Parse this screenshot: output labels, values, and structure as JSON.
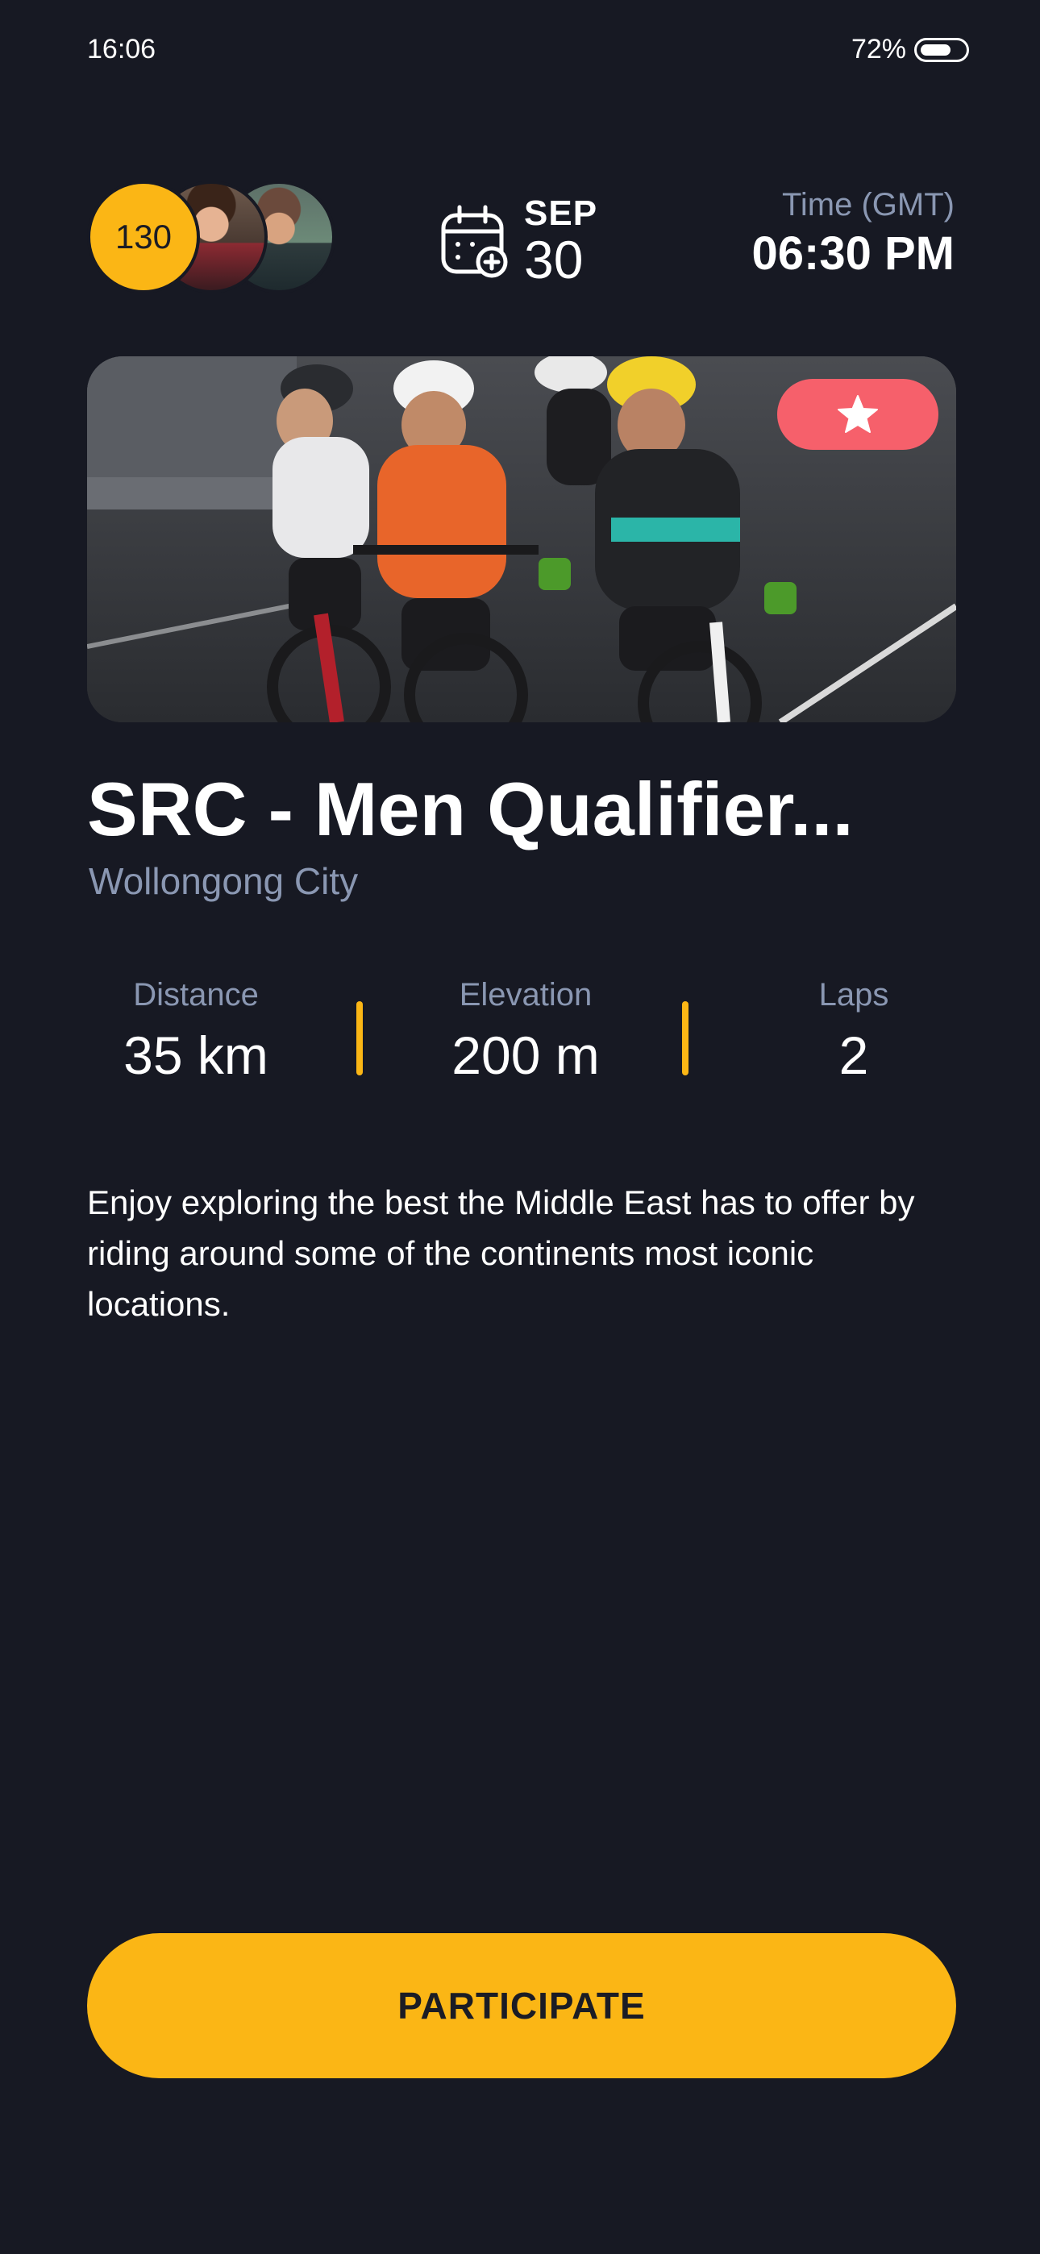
{
  "status_bar": {
    "time": "16:06",
    "battery_text": "72%",
    "battery_level": 0.72
  },
  "header": {
    "participant_count": "130",
    "date": {
      "month": "SEP",
      "day": "30"
    },
    "time": {
      "label": "Time (GMT)",
      "value": "06:30 PM"
    }
  },
  "event": {
    "title": "SRC - Men Qualifier...",
    "location": "Wollongong City",
    "stats": [
      {
        "label": "Distance",
        "value": "35 km"
      },
      {
        "label": "Elevation",
        "value": "200 m"
      },
      {
        "label": "Laps",
        "value": "2"
      }
    ],
    "description": "Enjoy exploring the best the Middle East has to offer by riding around some of the continents most iconic locations."
  },
  "actions": {
    "participate_label": "PARTICIPATE"
  },
  "colors": {
    "background": "#171923",
    "accent": "#fbb615",
    "favorite": "#f6606b",
    "muted_text": "#8a97b2"
  },
  "icons": {
    "calendar": "calendar-add-icon",
    "favorite": "star-icon",
    "battery": "battery-icon"
  }
}
